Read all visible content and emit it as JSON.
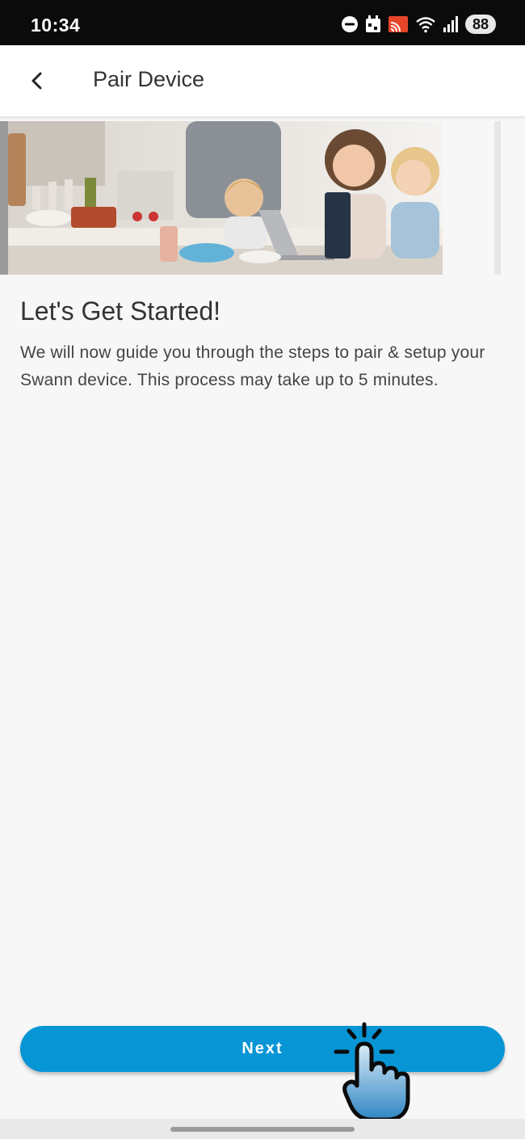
{
  "status_bar": {
    "time": "10:34",
    "icons": [
      "do-not-disturb-icon",
      "calendar-icon",
      "cast-icon",
      "wifi-icon",
      "signal-icon"
    ],
    "battery": "88"
  },
  "app_bar": {
    "back_icon": "chevron-left-icon",
    "title": "Pair Device"
  },
  "hero": {
    "image_icon": "family-kitchen-photo"
  },
  "content": {
    "heading": "Let's Get Started!",
    "body": "We will now guide you through the steps to pair & setup your Swann device. This process may take up to 5 minutes."
  },
  "actions": {
    "next_label": "Next"
  },
  "colors": {
    "accent": "#0895d6",
    "cast_icon": "#e8462b",
    "status_bar_bg": "#0b0b0b",
    "background": "#f7f7f8"
  }
}
